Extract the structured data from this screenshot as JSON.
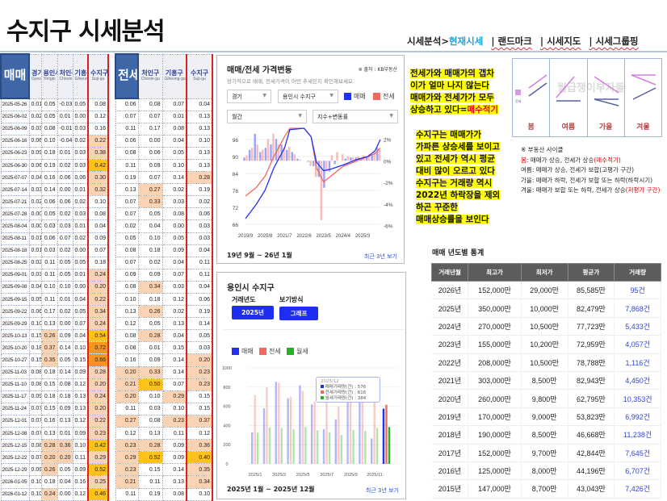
{
  "title": "수지구 시세분석",
  "nav": {
    "prefix": "시세분석>",
    "current": "현재시세",
    "items": [
      "| 랜드마크",
      "| 시세지도",
      "| 시세그룹핑"
    ]
  },
  "sale_table": {
    "corner": "매매",
    "headers": [
      {
        "ko": "경기도",
        "en": "Gyeonggi-do"
      },
      {
        "ko": "용인시",
        "en": "Yongin"
      },
      {
        "ko": "처인구",
        "en": "Cheoin-gu"
      },
      {
        "ko": "기흥구",
        "en": "Giheung-gu"
      },
      {
        "ko": "수지구",
        "en": "Suji-gu"
      }
    ],
    "rows": [
      [
        "2025-05-26",
        "0.01",
        "0.05",
        "-0.03",
        "0.05",
        "0.08"
      ],
      [
        "2025-06-02",
        "0.02",
        "0.05",
        "0.01",
        "0.00",
        "0.12"
      ],
      [
        "2025-06-09",
        "0.03",
        "0.08",
        "-0.01",
        "0.03",
        "0.16"
      ],
      [
        "2025-06-16",
        "0.06",
        "0.10",
        "-0.04",
        "0.02",
        "0.22"
      ],
      [
        "2025-06-23",
        "0.09",
        "0.18",
        "0.01",
        "0.03",
        "0.38"
      ],
      [
        "2025-06-30",
        "0.06",
        "0.19",
        "0.02",
        "0.03",
        "0.42"
      ],
      [
        "2025-07-07",
        "0.04",
        "0.16",
        "0.06",
        "0.06",
        "0.30"
      ],
      [
        "2025-07-14",
        "0.03",
        "0.14",
        "0.00",
        "0.01",
        "0.32"
      ],
      [
        "2025-07-21",
        "0.02",
        "0.06",
        "0.06",
        "0.02",
        "0.10"
      ],
      [
        "2025-07-28",
        "0.00",
        "0.05",
        "0.02",
        "0.03",
        "0.08"
      ],
      [
        "2025-08-04",
        "0.00",
        "0.03",
        "0.03",
        "0.01",
        "0.04"
      ],
      [
        "2025-08-11",
        "0.01",
        "0.06",
        "0.07",
        "0.02",
        "0.09"
      ],
      [
        "2025-08-18",
        "0.01",
        "0.03",
        "0.02",
        "0.00",
        "0.07"
      ],
      [
        "2025-08-25",
        "0.02",
        "0.11",
        "0.05",
        "0.05",
        "0.18"
      ],
      [
        "2025-09-01",
        "0.03",
        "0.11",
        "0.05",
        "0.01",
        "0.24"
      ],
      [
        "2025-09-08",
        "0.04",
        "0.10",
        "0.10",
        "0.00",
        "0.20"
      ],
      [
        "2025-09-15",
        "0.05",
        "0.11",
        "0.01",
        "0.04",
        "0.22"
      ],
      [
        "2025-09-22",
        "0.06",
        "0.17",
        "0.02",
        "0.05",
        "0.34"
      ],
      [
        "2025-09-29",
        "0.10",
        "0.13",
        "0.00",
        "0.07",
        "0.24"
      ],
      [
        "2025-10-13",
        "0.15",
        "0.26",
        "0.09",
        "0.04",
        "0.54"
      ],
      [
        "2025-10-20",
        "0.18",
        "0.37",
        "0.14",
        "0.10",
        "0.72"
      ],
      [
        "2025-10-27",
        "0.15",
        "0.35",
        "0.05",
        "0.15",
        "0.66"
      ],
      [
        "2025-11-03",
        "0.08",
        "0.18",
        "0.14",
        "0.09",
        "0.28"
      ],
      [
        "2025-11-10",
        "0.08",
        "0.15",
        "0.08",
        "0.12",
        "0.20"
      ],
      [
        "2025-11-17",
        "0.09",
        "0.18",
        "0.18",
        "0.13",
        "0.24"
      ],
      [
        "2025-11-24",
        "0.07",
        "0.15",
        "0.09",
        "0.13",
        "0.20"
      ],
      [
        "2025-12-01",
        "0.07",
        "0.16",
        "0.13",
        "0.12",
        "0.22"
      ],
      [
        "2025-12-08",
        "0.07",
        "0.13",
        "0.01",
        "0.09",
        "0.23"
      ],
      [
        "2025-12-15",
        "0.08",
        "0.28",
        "0.36",
        "0.10",
        "0.42"
      ],
      [
        "2025-12-22",
        "0.07",
        "0.20",
        "0.20",
        "0.11",
        "0.29"
      ],
      [
        "2025-12-29",
        "0.09",
        "0.26",
        "0.05",
        "0.09",
        "0.52"
      ],
      [
        "2026-01-05",
        "0.10",
        "0.18",
        "0.04",
        "0.16",
        "0.25"
      ],
      [
        "2026-01-12",
        "0.10",
        "0.24",
        "0.00",
        "0.12",
        "0.46"
      ]
    ]
  },
  "jeonse_table": {
    "corner": "전세",
    "headers": [
      {
        "ko": "처인구",
        "en": "Cheoin-gu"
      },
      {
        "ko": "기흥구",
        "en": "Giheung-gu"
      },
      {
        "ko": "수지구",
        "en": "Suji-gu"
      }
    ],
    "rows": [
      [
        "0.06",
        "0.08",
        "0.07",
        "0.04"
      ],
      [
        "0.07",
        "0.07",
        "0.01",
        "0.13"
      ],
      [
        "0.11",
        "0.17",
        "0.08",
        "0.13"
      ],
      [
        "0.06",
        "0.00",
        "0.04",
        "0.10"
      ],
      [
        "0.08",
        "0.06",
        "0.05",
        "0.13"
      ],
      [
        "0.11",
        "0.09",
        "0.10",
        "0.13"
      ],
      [
        "0.19",
        "0.07",
        "0.14",
        "0.28"
      ],
      [
        "0.13",
        "0.27",
        "0.02",
        "0.19"
      ],
      [
        "0.07",
        "0.33",
        "0.03",
        "0.02"
      ],
      [
        "0.07",
        "0.05",
        "0.08",
        "0.06"
      ],
      [
        "0.02",
        "0.04",
        "0.00",
        "0.03"
      ],
      [
        "0.05",
        "0.10",
        "0.05",
        "0.03"
      ],
      [
        "0.08",
        "0.18",
        "0.09",
        "0.04"
      ],
      [
        "0.07",
        "0.02",
        "0.04",
        "0.11"
      ],
      [
        "0.09",
        "0.09",
        "0.07",
        "0.11"
      ],
      [
        "0.08",
        "0.34",
        "0.03",
        "0.04"
      ],
      [
        "0.10",
        "0.18",
        "0.12",
        "0.06"
      ],
      [
        "0.13",
        "0.26",
        "0.02",
        "0.19"
      ],
      [
        "0.12",
        "0.05",
        "0.13",
        "0.14"
      ],
      [
        "0.08",
        "0.28",
        "0.04",
        "0.05"
      ],
      [
        "0.08",
        "0.01",
        "0.15",
        "0.03"
      ],
      [
        "0.16",
        "0.09",
        "0.14",
        "0.20"
      ],
      [
        "0.20",
        "0.33",
        "0.14",
        "0.23"
      ],
      [
        "0.21",
        "0.50",
        "0.07",
        "0.23"
      ],
      [
        "0.20",
        "0.10",
        "0.29",
        "0.15"
      ],
      [
        "0.11",
        "0.03",
        "0.10",
        "0.15"
      ],
      [
        "0.27",
        "0.08",
        "0.23",
        "0.37"
      ],
      [
        "0.12",
        "0.13",
        "0.11",
        "0.12"
      ],
      [
        "0.23",
        "0.28",
        "0.09",
        "0.36"
      ],
      [
        "0.29",
        "0.52",
        "0.09",
        "0.40"
      ],
      [
        "0.23",
        "0.15",
        "0.14",
        "0.35"
      ],
      [
        "0.21",
        "0.11",
        "0.13",
        "0.34"
      ],
      [
        "0.11",
        "0.19",
        "0.08",
        "0.10"
      ]
    ]
  },
  "price_panel": {
    "title": "매매/전세 가격변동",
    "source": "※ 출처 : KB부동산",
    "subtitle": "장기적으로 매매, 전세가격이 어떤 추세인지 확인해보세요.",
    "select_region": "경기",
    "select_district": "용인시 수지구",
    "select_period": "월간",
    "select_mode": "지수+변동률",
    "legend_sale": "매매",
    "legend_jeonse": "전세",
    "range": "19년 9월 ~ 26년 1월",
    "link": "최근 3년 보기"
  },
  "volume_panel": {
    "title": "용인시 수지구",
    "year_label": "거래년도",
    "view_label": "보기방식",
    "year_button": "2025년",
    "view_button": "그래프",
    "legend": [
      "매매",
      "전세",
      "월세"
    ],
    "range": "2025년 1월 ~ 2025년 12월",
    "link": "최근 3년 보기",
    "tooltip": {
      "title": "2025/12",
      "lines": [
        "매매거래량(건) : 576",
        "전세거래량(건) : 616",
        "월세거래량(건) : 384"
      ]
    }
  },
  "colors": {
    "sale": "#2430f0",
    "jeonse": "#f26a5e",
    "monthly": "#22b322",
    "accent": "#3f67a8"
  },
  "chart_data": [
    {
      "type": "line+bar",
      "title": "매매/전세 가격변동",
      "left_ylim": [
        66,
        100
      ],
      "left_ticks": [
        "96",
        "90",
        "84",
        "78",
        "72",
        "66"
      ],
      "right_ticks": [
        "2%",
        "0%",
        "-2%",
        "-4%",
        "-6%"
      ],
      "x_ticks": [
        "2019/9",
        "2020/8",
        "2021/7",
        "2022/6",
        "2023/5",
        "2024/4",
        "2025/3"
      ],
      "index_points": [
        {
          "x": "2019/9",
          "sale": 68,
          "jeonse": 76
        },
        {
          "x": "2020/3",
          "sale": 73,
          "jeonse": 79
        },
        {
          "x": "2020/8",
          "sale": 78,
          "jeonse": 83
        },
        {
          "x": "2021/1",
          "sale": 86,
          "jeonse": 90
        },
        {
          "x": "2021/7",
          "sale": 93,
          "jeonse": 97
        },
        {
          "x": "2021/10",
          "sale": 99.5,
          "jeonse": 100
        },
        {
          "x": "2022/6",
          "sale": 100,
          "jeonse": 100
        },
        {
          "x": "2022/10",
          "sale": 97,
          "jeonse": 97
        },
        {
          "x": "2023/1",
          "sale": 88,
          "jeonse": 86
        },
        {
          "x": "2023/5",
          "sale": 85,
          "jeonse": 81
        },
        {
          "x": "2023/9",
          "sale": 85.5,
          "jeonse": 83
        },
        {
          "x": "2024/4",
          "sale": 87,
          "jeonse": 86.5
        },
        {
          "x": "2024/12",
          "sale": 89,
          "jeonse": 88.5
        },
        {
          "x": "2025/6",
          "sale": 90,
          "jeonse": 90
        },
        {
          "x": "2025/10",
          "sale": 92,
          "jeonse": 91
        },
        {
          "x": "2026/1",
          "sale": 96,
          "jeonse": 93
        }
      ],
      "change_x": [
        "2019/9",
        "2019/12",
        "2020/3",
        "2020/6",
        "2020/9",
        "2020/12",
        "2021/3",
        "2021/6",
        "2021/9",
        "2021/12",
        "2022/3",
        "2022/6",
        "2022/9",
        "2022/12",
        "2023/3",
        "2023/6",
        "2023/9",
        "2023/12",
        "2024/3",
        "2024/6",
        "2024/9",
        "2024/12",
        "2025/3",
        "2025/6",
        "2025/9",
        "2025/12"
      ],
      "sale_change": [
        0.3,
        1.0,
        2.5,
        0.8,
        1.2,
        1.5,
        2.0,
        1.5,
        1.0,
        0.8,
        0.2,
        0.0,
        -0.1,
        -0.5,
        -1.5,
        -2.5,
        -1.0,
        -0.3,
        0.0,
        0.2,
        0.3,
        0.3,
        0.2,
        0.4,
        0.5,
        1.2
      ],
      "jeonse_change": [
        0.5,
        1.2,
        1.5,
        1.0,
        2.0,
        2.5,
        1.5,
        1.2,
        1.3,
        0.6,
        0.1,
        0.0,
        -0.5,
        -1.5,
        -5.5,
        -1.0,
        0.5,
        0.8,
        0.6,
        0.4,
        0.3,
        0.4,
        0.5,
        0.6,
        0.8,
        1.0
      ]
    },
    {
      "type": "bar",
      "title": "용인시 수지구 거래량",
      "ylim": [
        0,
        1000
      ],
      "y_ticks": [
        "1000",
        "800",
        "600",
        "400",
        "200",
        "0"
      ],
      "categories": [
        "2025/1",
        "2025/2",
        "2025/3",
        "2025/4",
        "2025/5",
        "2025/6",
        "2025/7",
        "2025/8",
        "2025/9",
        "2025/10",
        "2025/11",
        "2025/12"
      ],
      "x_tick_labels": [
        "2025/1",
        "2025/3",
        "2025/5",
        "2025/7",
        "2025/9",
        "2025/11"
      ],
      "series": [
        {
          "name": "매매",
          "values": [
            330,
            580,
            855,
            685,
            820,
            620,
            360,
            465,
            650,
            640,
            265,
            576
          ]
        },
        {
          "name": "전세",
          "values": [
            715,
            795,
            845,
            700,
            760,
            650,
            650,
            600,
            650,
            650,
            650,
            616
          ]
        },
        {
          "name": "월세",
          "values": [
            325,
            380,
            375,
            360,
            385,
            350,
            325,
            300,
            355,
            345,
            375,
            384
          ]
        }
      ]
    }
  ],
  "notes": {
    "block1": [
      "전세가와 매매가의 갭차",
      "이가 얼마 나지 않는다",
      "매매가와 전세가가 모두",
      "상승하고 있다="
    ],
    "block1_red": "매수적기",
    "block2": [
      "수지구는 매매가가",
      "가파른 상승세를 보이고",
      "있고 전세가 역시 평균",
      "대비 많이 오르고 있다",
      "수지구는 거래량 역시",
      "2022년 하락장을 제외",
      "하곤 꾸준한",
      "매매상승률을 보인다"
    ]
  },
  "cycle": {
    "seasons": [
      "봄",
      "여름",
      "가을",
      "겨울"
    ],
    "watermark": "월급쟁이부자들",
    "mini_legend": "전세",
    "heading": "※ 부동산 사이클",
    "lines": [
      {
        "label": "봄",
        "text": ": 매매가 상승, 전세가 상승",
        "note": "(매수적기)"
      },
      {
        "label": "여름",
        "text": ": 매매가 상승, 전세가 보합(고평가 구간)",
        "note": ""
      },
      {
        "label": "가을",
        "text": ": 매매가 하락, 전세가 보합 또는 하락(하락시기)",
        "note": ""
      },
      {
        "label": "겨울",
        "text": ": 매매가 보합 또는 하락, 전세가 상승",
        "note": "(저평가 구간)"
      }
    ]
  },
  "stats": {
    "title": "매매 년도별 통계",
    "headers": [
      "거래년월",
      "최고가",
      "최저가",
      "평균가",
      "거래량"
    ],
    "rows": [
      [
        "2026년",
        "152,000만",
        "29,000만",
        "85,585만",
        "95건"
      ],
      [
        "2025년",
        "350,000만",
        "10,000만",
        "82,479만",
        "7,868건"
      ],
      [
        "2024년",
        "270,000만",
        "10,500만",
        "77,723만",
        "5,433건"
      ],
      [
        "2023년",
        "155,000만",
        "10,200만",
        "72,959만",
        "4,057건"
      ],
      [
        "2022년",
        "208,000만",
        "10,500만",
        "78,788만",
        "1,116건"
      ],
      [
        "2021년",
        "303,000만",
        "8,500만",
        "82,943만",
        "4,450건"
      ],
      [
        "2020년",
        "260,000만",
        "9,800만",
        "62,795만",
        "10,353건"
      ],
      [
        "2019년",
        "170,000만",
        "9,000만",
        "53,823만",
        "6,992건"
      ],
      [
        "2018년",
        "190,000만",
        "8,500만",
        "46,668만",
        "11,238건"
      ],
      [
        "2017년",
        "152,000만",
        "9,700만",
        "42,844만",
        "7,645건"
      ],
      [
        "2016년",
        "125,000만",
        "8,000만",
        "44,196만",
        "6,707건"
      ],
      [
        "2015년",
        "147,000만",
        "8,700만",
        "43,043만",
        "7,426건"
      ]
    ]
  }
}
